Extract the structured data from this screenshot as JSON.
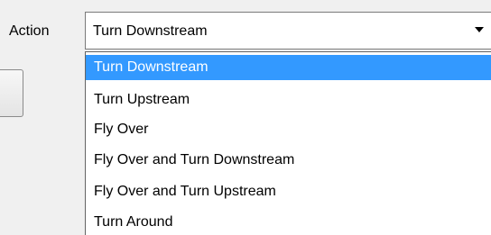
{
  "form": {
    "action_label": "Action",
    "action_value": "Turn Downstream"
  },
  "dropdown": {
    "options": [
      "Turn Downstream",
      "Turn Upstream",
      "Fly Over",
      "Fly Over and Turn Downstream",
      "Fly Over and Turn Upstream",
      "Turn Around"
    ],
    "selected_index": 0
  },
  "colors": {
    "highlight": "#3399ff",
    "highlight_text": "#ffffff",
    "window_bg": "#f0f0f0"
  },
  "icons": {
    "dropdown_arrow": "chevron-down-icon"
  }
}
